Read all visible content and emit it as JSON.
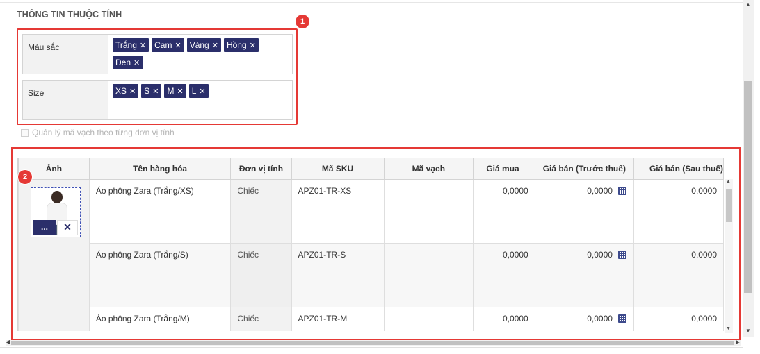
{
  "section": {
    "title": "THÔNG TIN THUỘC TÍNH"
  },
  "attributes": [
    {
      "label": "Màu sắc",
      "values": [
        "Trắng",
        "Cam",
        "Vàng",
        "Hồng",
        "Đen"
      ]
    },
    {
      "label": "Size",
      "values": [
        "XS",
        "S",
        "M",
        "L"
      ]
    }
  ],
  "barcode_option": {
    "label": "Quản lý mã vạch theo từng đơn vị tính",
    "checked": false
  },
  "annotations": {
    "badge1": "1",
    "badge2": "2"
  },
  "table": {
    "columns": [
      "Ảnh",
      "Tên hàng hóa",
      "Đơn vị tính",
      "Mã SKU",
      "Mã vạch",
      "Giá mua",
      "Giá bán (Trước thuế)",
      "Giá bán (Sau thuế)"
    ],
    "rows": [
      {
        "name": "Áo phông Zara (Trắng/XS)",
        "unit": "Chiếc",
        "sku": "APZ01-TR-XS",
        "barcode": "",
        "buy_price": "0,0000",
        "sell_before_tax": "0,0000",
        "sell_after_tax": "0,0000"
      },
      {
        "name": "Áo phông Zara (Trắng/S)",
        "unit": "Chiếc",
        "sku": "APZ01-TR-S",
        "barcode": "",
        "buy_price": "0,0000",
        "sell_before_tax": "0,0000",
        "sell_after_tax": "0,0000"
      },
      {
        "name": "Áo phông Zara (Trắng/M)",
        "unit": "Chiếc",
        "sku": "APZ01-TR-M",
        "barcode": "",
        "buy_price": "0,0000",
        "sell_before_tax": "0,0000",
        "sell_after_tax": "0,0000"
      }
    ],
    "image_buttons": {
      "browse": "...",
      "remove": "✕"
    }
  },
  "icons": {
    "tag_remove": "close-icon",
    "price_calc": "calculator-icon"
  },
  "colors": {
    "tag_bg": "#2b2f6b",
    "highlight": "#e53935",
    "accent": "#3f51b5"
  }
}
